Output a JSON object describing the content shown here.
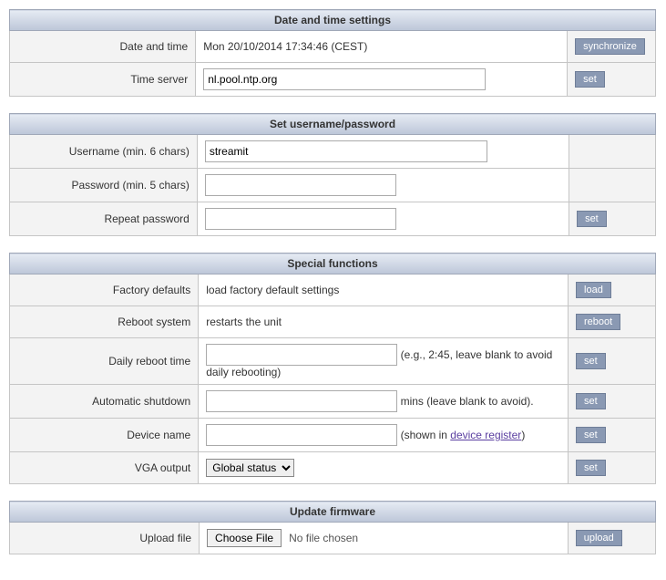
{
  "datetime": {
    "title": "Date and time settings",
    "rows": {
      "datetimeLabel": "Date and time",
      "datetimeValue": "Mon 20/10/2014 17:34:46 (CEST)",
      "syncBtn": "synchronize",
      "timeServerLabel": "Time server",
      "timeServerValue": "nl.pool.ntp.org",
      "setBtn": "set"
    }
  },
  "userpass": {
    "title": "Set username/password",
    "usernameLabel": "Username (min. 6 chars)",
    "usernameValue": "streamit",
    "passwordLabel": "Password (min. 5 chars)",
    "passwordValue": "",
    "repeatLabel": "Repeat password",
    "repeatValue": "",
    "setBtn": "set"
  },
  "special": {
    "title": "Special functions",
    "factoryLabel": "Factory defaults",
    "factoryDesc": "load factory default settings",
    "loadBtn": "load",
    "rebootLabel": "Reboot system",
    "rebootDesc": "restarts the unit",
    "rebootBtn": "reboot",
    "dailyLabel": "Daily reboot time",
    "dailyValue": "",
    "dailyHint": " (e.g., 2:45, leave blank to avoid daily rebooting)",
    "autoLabel": "Automatic shutdown",
    "autoValue": "",
    "autoHint": " mins (leave blank to avoid).",
    "devLabel": "Device name",
    "devValue": "",
    "devHintPre": " (shown in ",
    "devLink": "device register",
    "devHintPost": ")",
    "vgaLabel": "VGA output",
    "vgaSelected": "Global status",
    "setBtn": "set"
  },
  "firmware": {
    "title": "Update firmware",
    "uploadLabel": "Upload file",
    "chooseBtn": "Choose File",
    "noFile": "No file chosen",
    "uploadBtn": "upload"
  }
}
